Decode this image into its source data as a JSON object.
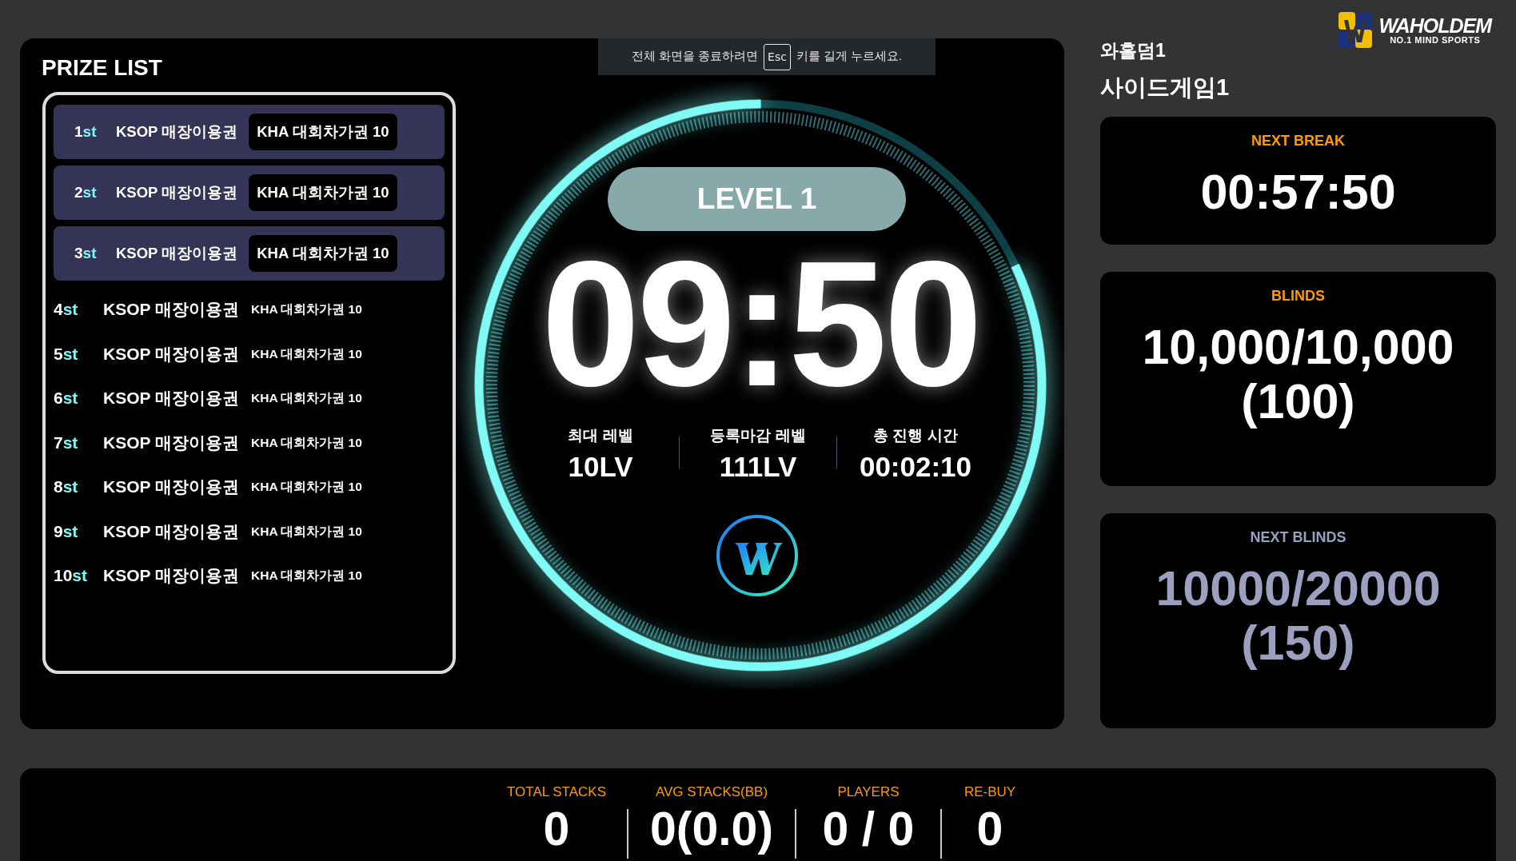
{
  "toast": {
    "before": "전체 화면을 종료하려면",
    "key": "Esc",
    "after": "키를 길게 누르세요."
  },
  "prize_list": {
    "title": "PRIZE LIST",
    "items": [
      {
        "kind": "featured",
        "rank": "1",
        "suffix": "st",
        "name": "KSOP 매장이용권",
        "prize": "KHA 대회차가권 10"
      },
      {
        "kind": "featured",
        "rank": "2",
        "suffix": "st",
        "name": "KSOP 매장이용권",
        "prize": "KHA 대회차가권 10"
      },
      {
        "kind": "featured",
        "rank": "3",
        "suffix": "st",
        "name": "KSOP 매장이용권",
        "prize": "KHA 대회차가권 10"
      },
      {
        "kind": "plain",
        "rank": "4",
        "suffix": "st",
        "name": "KSOP 매장이용권",
        "prize": "KHA 대회차가권 10"
      },
      {
        "kind": "plain",
        "rank": "5",
        "suffix": "st",
        "name": "KSOP 매장이용권",
        "prize": "KHA 대회차가권 10"
      },
      {
        "kind": "plain",
        "rank": "6",
        "suffix": "st",
        "name": "KSOP 매장이용권",
        "prize": "KHA 대회차가권 10"
      },
      {
        "kind": "plain",
        "rank": "7",
        "suffix": "st",
        "name": "KSOP 매장이용권",
        "prize": "KHA 대회차가권 10"
      },
      {
        "kind": "plain",
        "rank": "8",
        "suffix": "st",
        "name": "KSOP 매장이용권",
        "prize": "KHA 대회차가권 10"
      },
      {
        "kind": "plain",
        "rank": "9",
        "suffix": "st",
        "name": "KSOP 매장이용권",
        "prize": "KHA 대회차가권 10"
      },
      {
        "kind": "plain",
        "rank": "10",
        "suffix": "st",
        "name": "KSOP 매장이용권",
        "prize": "KHA 대회차가권 10"
      }
    ]
  },
  "clock": {
    "level": 0.82,
    "level_label": "LEVEL 1",
    "time": "09:50",
    "stats": [
      {
        "label": "최대 레벨",
        "value": "10LV"
      },
      {
        "label": "등록마감 레벨",
        "value": "111LV"
      },
      {
        "label": "총 진행 시간",
        "value": "00:02:10"
      }
    ]
  },
  "header": {
    "venue": "와홀덤1",
    "game": "사이드게임1"
  },
  "logo": {
    "name": "WAHOLDEM",
    "tagline": "NO.1 MIND SPORTS"
  },
  "cards": [
    {
      "kind": "current",
      "title": "NEXT BREAK",
      "lines": [
        "00:57:50"
      ]
    },
    {
      "kind": "current",
      "title": "BLINDS",
      "lines": [
        "10,000/10,000",
        "(100)"
      ]
    },
    {
      "kind": "upcoming",
      "title": "NEXT BLINDS",
      "lines": [
        "10000/20000",
        "(150)"
      ]
    }
  ],
  "footer_stats": [
    {
      "label": "TOTAL STACKS",
      "value": "0"
    },
    {
      "label": "AVG STACKS(BB)",
      "value": "0(0.0)"
    },
    {
      "label": "PLAYERS",
      "value": "0 / 0"
    },
    {
      "label": "RE-BUY",
      "value": "0"
    }
  ]
}
